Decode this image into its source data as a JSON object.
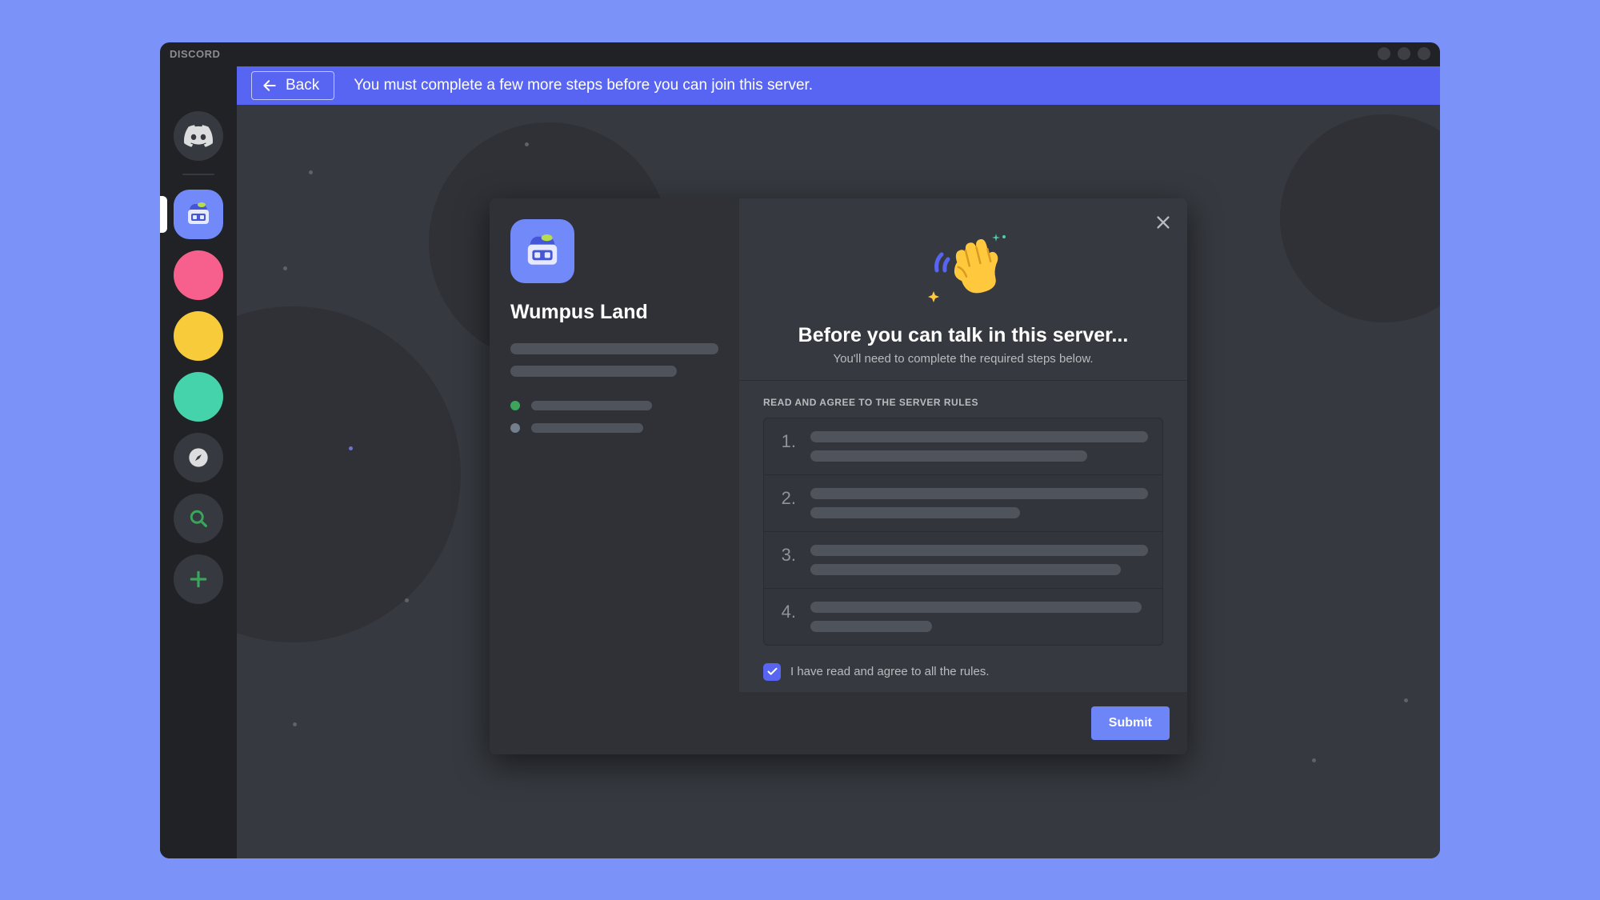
{
  "brand": "DISCORD",
  "banner": {
    "back_label": "Back",
    "message": "You must complete a few more steps before you can join this server."
  },
  "server_rail": {
    "home_icon": "discord-logo-icon",
    "selected_server": "Wumpus Land",
    "servers": [
      {
        "color": "pink"
      },
      {
        "color": "yellow"
      },
      {
        "color": "teal"
      }
    ],
    "explore_icon": "compass-icon",
    "search_icon": "search-icon",
    "add_icon": "plus-icon"
  },
  "modal": {
    "server_name": "Wumpus Land",
    "title": "Before you can talk in this server...",
    "subtitle": "You'll need to complete the required steps below.",
    "rules_header": "READ AND AGREE TO THE SERVER RULES",
    "rules": [
      {
        "num": "1."
      },
      {
        "num": "2."
      },
      {
        "num": "3."
      },
      {
        "num": "4."
      }
    ],
    "agree_label": "I have read and agree to all the rules.",
    "agree_checked": true,
    "submit_label": "Submit"
  },
  "colors": {
    "blurple": "#5865f2",
    "online": "#3ba55c",
    "offline": "#747f8d"
  }
}
